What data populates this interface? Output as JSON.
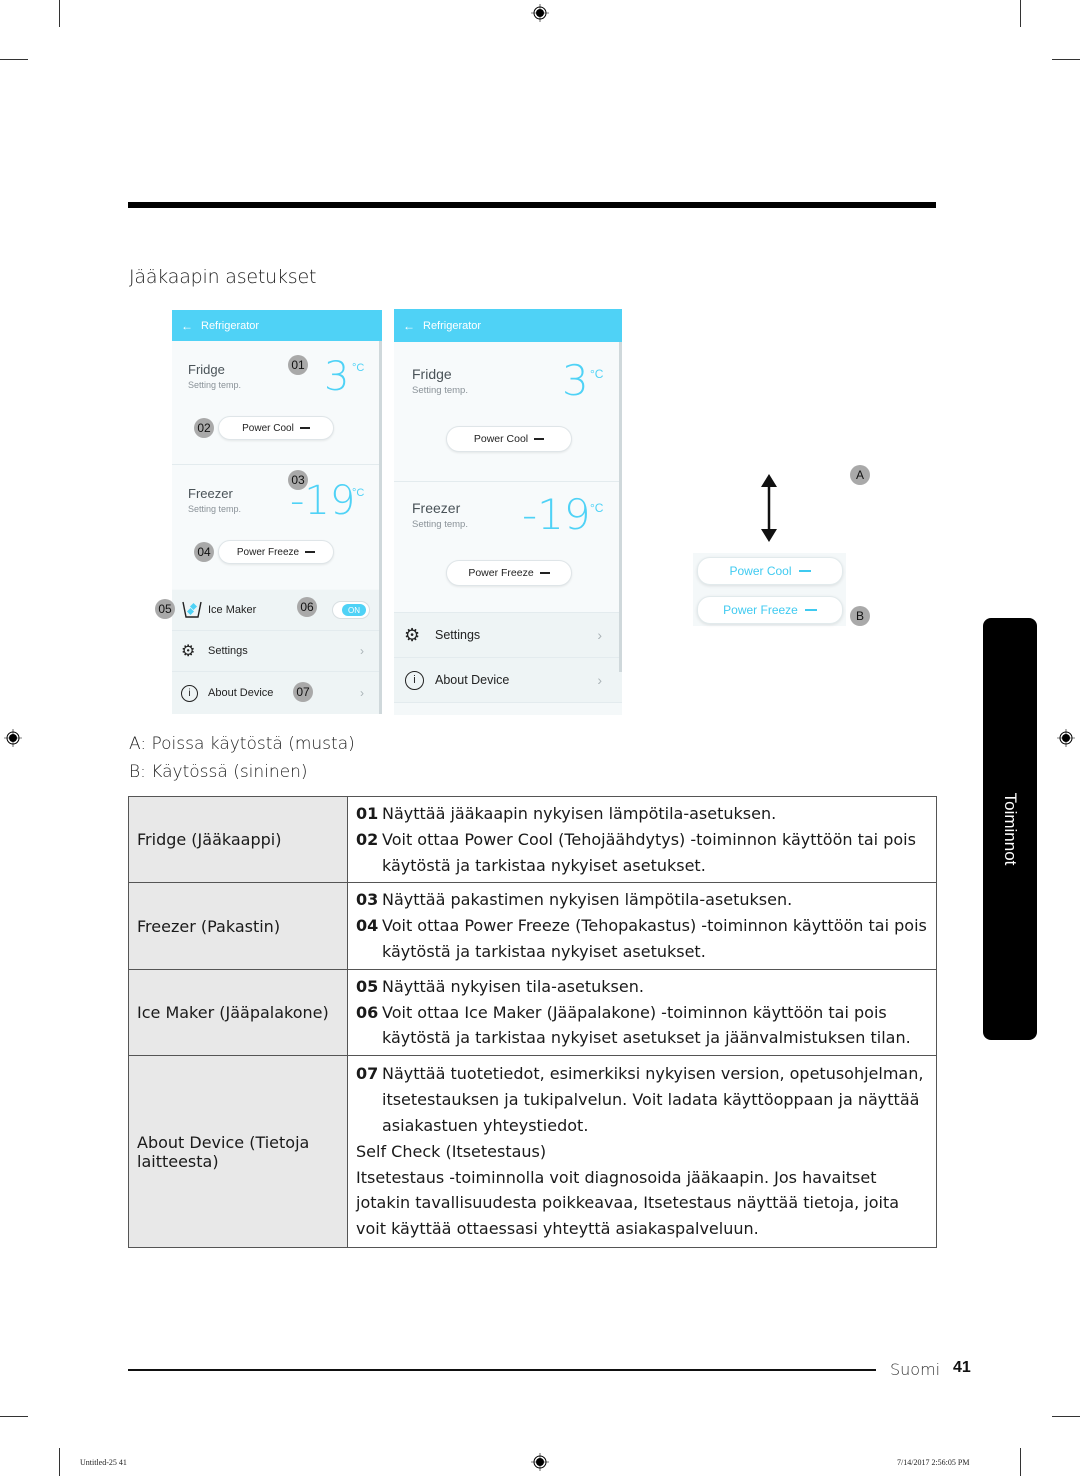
{
  "section_title": "Jääkaapin asetukset",
  "screen_left": {
    "header_title": "Refrigerator",
    "fridge": {
      "label": "Fridge",
      "sub": "Setting temp.",
      "temp": "3",
      "unit": "°C",
      "button": "Power Cool"
    },
    "freezer": {
      "label": "Freezer",
      "sub": "Setting temp.",
      "temp": "-19",
      "unit": "°C",
      "button": "Power Freeze"
    },
    "ice_maker": {
      "label": "Ice Maker",
      "toggle": "ON"
    },
    "settings": "Settings",
    "about": "About Device",
    "badges": [
      "01",
      "02",
      "03",
      "04",
      "05",
      "06",
      "07"
    ]
  },
  "screen_right": {
    "header_title": "Refrigerator",
    "fridge": {
      "label": "Fridge",
      "sub": "Setting temp.",
      "temp": "3",
      "unit": "°C",
      "button": "Power Cool"
    },
    "freezer": {
      "label": "Freezer",
      "sub": "Setting temp.",
      "temp": "-19",
      "unit": "°C",
      "button": "Power Freeze"
    },
    "settings": "Settings",
    "about": "About Device"
  },
  "state_example": {
    "marker_a": "A",
    "marker_b": "B",
    "buttons": [
      "Power Cool",
      "Power Freeze"
    ]
  },
  "legend": {
    "a": "A: Poissa käytöstä (musta)",
    "b": "B: Käytössä (sininen)"
  },
  "table": [
    {
      "key": "Fridge (Jääkaappi)",
      "items": [
        {
          "num": "01",
          "text": "Näyttää jääkaapin nykyisen lämpötila-asetuksen."
        },
        {
          "num": "02",
          "text": "Voit ottaa Power Cool (Tehojäähdytys) -toiminnon käyttöön tai pois käytöstä ja tarkistaa nykyiset asetukset."
        }
      ]
    },
    {
      "key": "Freezer (Pakastin)",
      "items": [
        {
          "num": "03",
          "text": "Näyttää pakastimen nykyisen lämpötila-asetuksen."
        },
        {
          "num": "04",
          "text": "Voit ottaa Power Freeze (Tehopakastus) -toiminnon käyttöön tai pois käytöstä ja tarkistaa nykyiset asetukset."
        }
      ]
    },
    {
      "key": "Ice Maker (Jääpalakone)",
      "items": [
        {
          "num": "05",
          "text": "Näyttää nykyisen tila-asetuksen."
        },
        {
          "num": "06",
          "text": "Voit ottaa Ice Maker (Jääpalakone) -toiminnon käyttöön tai pois käytöstä ja tarkistaa nykyiset asetukset ja jäänvalmistuksen tilan."
        }
      ]
    },
    {
      "key": "About Device (Tietoja laitteesta)",
      "items": [
        {
          "num": "07",
          "text": "Näyttää tuotetiedot, esimerkiksi nykyisen version, opetusohjelman, itsetestauksen ja tukipalvelun. Voit ladata käyttöoppaan ja näyttää asiakastuen yhteystiedot."
        }
      ],
      "self_check_title": "Self Check (Itsetestaus)",
      "self_check_text": "Itsetestaus -toiminnolla voit diagnosoida jääkaapin. Jos havaitset jotakin tavallisuudesta poikkeavaa, Itsetestaus näyttää tietoja, joita voit käyttää ottaessasi yhteyttä asiakaspalveluun."
    }
  ],
  "side_tab": "Toiminnot",
  "footer": {
    "language": "Suomi",
    "page": "41"
  },
  "print_info": {
    "file": "Untitled-25   41",
    "timestamp": "7/14/2017   2:56:05 PM"
  },
  "colors": {
    "accent": "#4fd2f6",
    "tab": "#000000",
    "table_key_bg": "#e8e8e8"
  }
}
